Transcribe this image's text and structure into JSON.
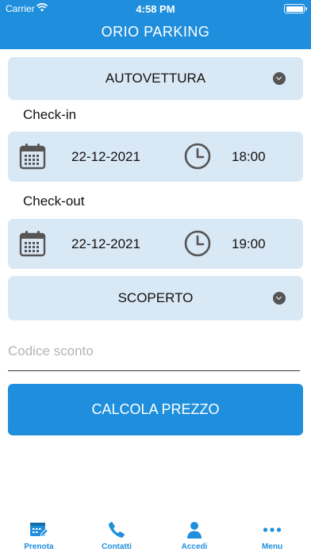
{
  "status_bar": {
    "carrier": "Carrier",
    "time": "4:58 PM"
  },
  "header": {
    "title": "ORIO PARKING"
  },
  "vehicle_select": {
    "value": "AUTOVETTURA",
    "icon": "chevron-down-icon"
  },
  "checkin": {
    "label": "Check-in",
    "date": "22-12-2021",
    "time": "18:00"
  },
  "checkout": {
    "label": "Check-out",
    "date": "22-12-2021",
    "time": "19:00"
  },
  "parking_select": {
    "value": "SCOPERTO",
    "icon": "chevron-down-icon"
  },
  "promo": {
    "placeholder": "Codice sconto",
    "value": ""
  },
  "cta": {
    "label": "CALCOLA PREZZO"
  },
  "tabs": [
    {
      "label": "Prenota",
      "icon": "calendar-edit-icon"
    },
    {
      "label": "Contatti",
      "icon": "phone-icon"
    },
    {
      "label": "Accedi",
      "icon": "user-icon"
    },
    {
      "label": "Menu",
      "icon": "more-dots-icon"
    }
  ],
  "colors": {
    "primary": "#1f8fdd",
    "field_bg": "#d9e8f5",
    "icon_gray": "#555555"
  }
}
